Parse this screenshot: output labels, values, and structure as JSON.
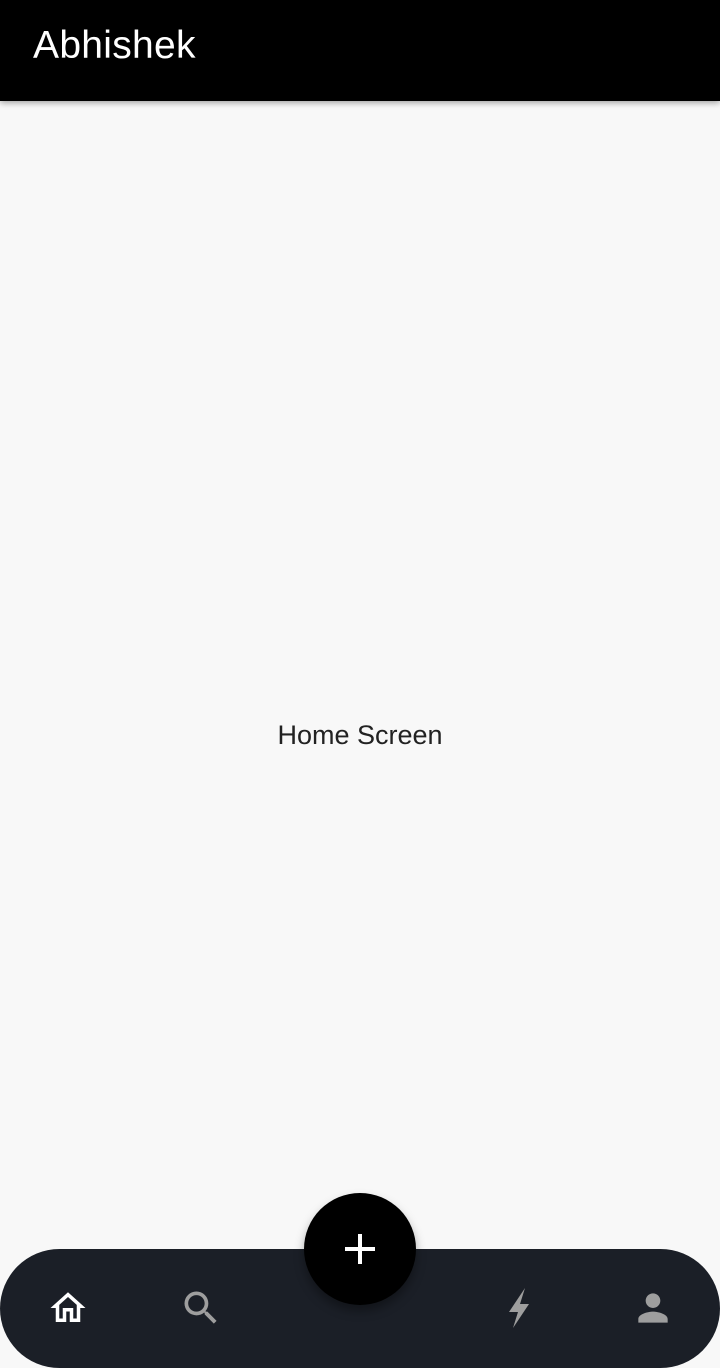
{
  "app_bar": {
    "title": "Abhishek"
  },
  "body": {
    "text": "Home Screen"
  },
  "bottom_nav": {
    "items": [
      {
        "icon": "home-icon",
        "selected": true
      },
      {
        "icon": "search-icon",
        "selected": false
      },
      {
        "icon": "bolt-icon",
        "selected": false
      },
      {
        "icon": "person-icon",
        "selected": false
      }
    ],
    "fab_icon": "plus-icon"
  },
  "colors": {
    "app_bar": "#000000",
    "background": "#f8f8f8",
    "bottom_bar": "#1b1f27",
    "fab": "#000000",
    "icon_selected": "#ffffff",
    "icon_unselected": "#9e9e9e"
  }
}
